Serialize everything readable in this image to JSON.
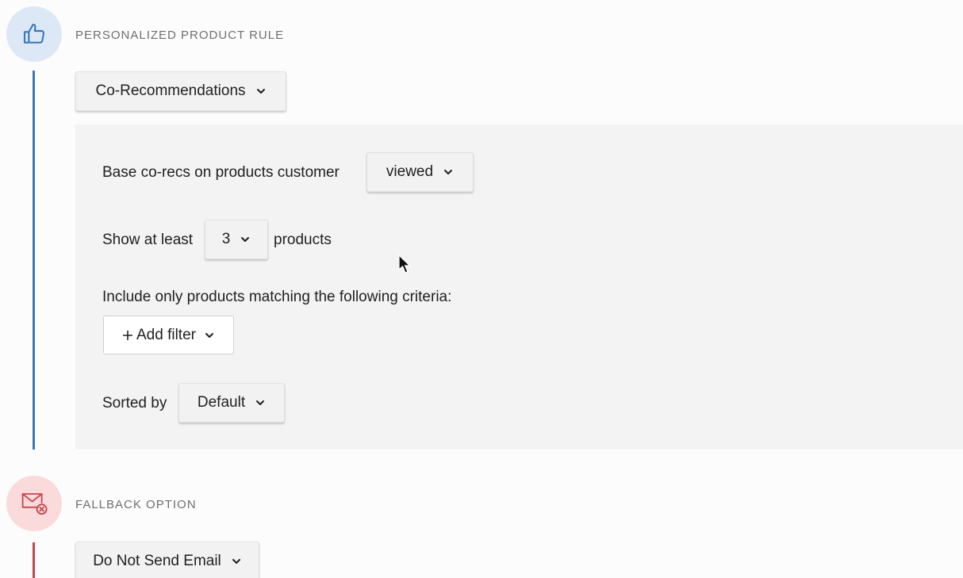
{
  "personalized": {
    "icon": "thumbs-up-icon",
    "title": "PERSONALIZED PRODUCT RULE",
    "rule_type": "Co-Recommendations",
    "base_prefix": "Base co-recs on products customer",
    "base_value": "viewed",
    "show_prefix": "Show at least",
    "show_value": "3",
    "show_suffix": "products",
    "criteria_label": "Include only products matching the following criteria:",
    "add_filter": "Add filter",
    "sorted_label": "Sorted by",
    "sorted_value": "Default"
  },
  "fallback": {
    "icon": "email-cancel-icon",
    "title": "FALLBACK OPTION",
    "value": "Do Not Send Email"
  },
  "colors": {
    "primary_accent": "#3a78b8",
    "fallback_accent": "#c64550"
  }
}
